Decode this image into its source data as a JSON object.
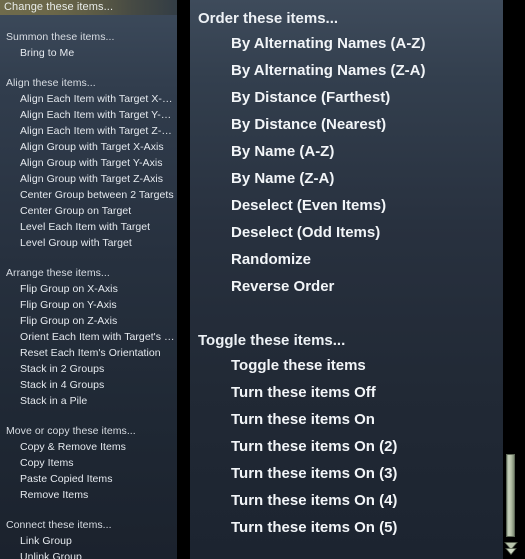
{
  "colors": {
    "panel_bg_top": "#3e4b5b",
    "panel_bg_bottom": "#1c2430",
    "header_highlight": "#6f6b4c",
    "text_primary": "#f2f5f8",
    "text_group": "#d8dde3",
    "scroll_thumb": "#c8d3bd",
    "gap_black": "#000000"
  },
  "left_panel": {
    "header": {
      "label": "Change these items...",
      "selected": true
    },
    "scrollbar": {
      "up_arrow_icon": "chevron-up-icon",
      "thumb_top_pct": 2,
      "thumb_height_pct": 9
    },
    "groups": [
      {
        "title": "Summon these items...",
        "items": [
          "Bring to Me"
        ]
      },
      {
        "title": "Align these items...",
        "items": [
          "Align Each Item with Target X-…",
          "Align Each Item with Target Y-…",
          "Align Each Item with Target Z-…",
          "Align Group with Target X-Axis",
          "Align Group with Target Y-Axis",
          "Align Group with Target Z-Axis",
          "Center Group between 2 Targets",
          "Center Group on Target",
          "Level Each Item with Target",
          "Level Group with Target"
        ]
      },
      {
        "title": "Arrange these items...",
        "items": [
          "Flip Group on X-Axis",
          "Flip Group on Y-Axis",
          "Flip Group on Z-Axis",
          "Orient Each Item with Target's …",
          "Reset Each Item's Orientation",
          "Stack in 2 Groups",
          "Stack in 4 Groups",
          "Stack in a Pile"
        ]
      },
      {
        "title": "Move or copy these items...",
        "items": [
          "Copy & Remove Items",
          "Copy Items",
          "Paste Copied Items",
          "Remove Items"
        ]
      },
      {
        "title": "Connect these items...",
        "items": [
          "Link Group",
          "Unlink Group"
        ]
      }
    ]
  },
  "right_panel": {
    "scrollbar": {
      "down_arrow_icon": "chevron-down-icon",
      "thumb_top_pct": 81,
      "thumb_height_pct": 15
    },
    "groups": [
      {
        "title": "Order these items...",
        "items": [
          "By Alternating Names (A-Z)",
          "By Alternating Names (Z-A)",
          "By Distance (Farthest)",
          "By Distance (Nearest)",
          "By Name (A-Z)",
          "By Name (Z-A)",
          "Deselect (Even Items)",
          "Deselect (Odd Items)",
          "Randomize",
          "Reverse Order"
        ]
      },
      {
        "title": "Toggle these items...",
        "items": [
          "Toggle these items",
          "Turn these items Off",
          "Turn these items On",
          "Turn these items On (2)",
          "Turn these items On (3)",
          "Turn these items On (4)",
          "Turn these items On (5)"
        ]
      }
    ]
  }
}
